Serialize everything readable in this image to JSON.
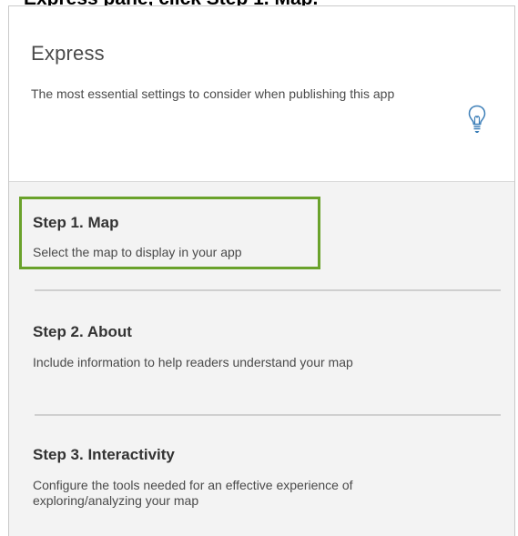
{
  "caption": "Express pane, click Step 1. Map.",
  "header": {
    "title": "Express",
    "description": "The most essential settings to consider when publishing this app",
    "hint_icon": "lightbulb-icon"
  },
  "steps": [
    {
      "title": "Step 1. Map",
      "description": "Select the map to display in your app",
      "highlighted": true
    },
    {
      "title": "Step 2. About",
      "description": "Include information to help readers understand your map",
      "highlighted": false
    },
    {
      "title": "Step 3. Interactivity",
      "description": "Configure the tools needed for an effective experience of exploring/analyzing your map",
      "highlighted": false
    }
  ],
  "colors": {
    "highlight": "#6aa22b",
    "steps_background": "#f3f3f3",
    "text": "#4a4a4a"
  }
}
